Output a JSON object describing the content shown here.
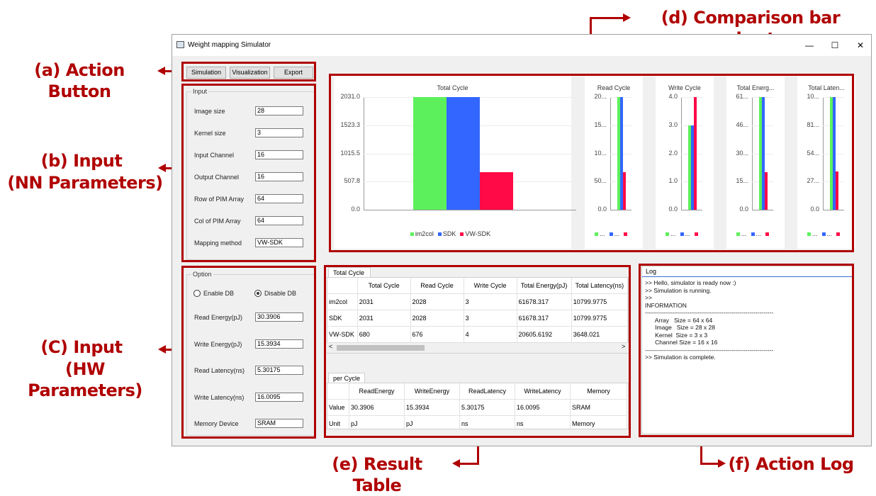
{
  "callouts": {
    "a": "(a) Action Button",
    "b1": "(b) Input",
    "b2": "(NN Parameters)",
    "c1": "(C) Input",
    "c2": "(HW Parameters)",
    "d": "(d) Comparison bar chart",
    "e": "(e) Result Table",
    "f": "(f) Action Log"
  },
  "window": {
    "title": "Weight mapping Simulator",
    "minimize": "—",
    "maximize": "☐",
    "close": "✕"
  },
  "toolbar": {
    "simulation": "Simulation",
    "visualization": "Visualization",
    "export": "Export"
  },
  "input_group": {
    "title": "Input",
    "fields": [
      {
        "label": "Image size",
        "value": "28"
      },
      {
        "label": "Kernel size",
        "value": "3"
      },
      {
        "label": "Input Channel",
        "value": "16"
      },
      {
        "label": "Output Channel",
        "value": "16"
      },
      {
        "label": "Row of PIM Array",
        "value": "64"
      },
      {
        "label": "Col of PIM Array",
        "value": "64"
      },
      {
        "label": "Mapping method",
        "value": "VW-SDK"
      }
    ]
  },
  "option_group": {
    "title": "Option",
    "enable_db": "Enable DB",
    "disable_db": "Disable DB",
    "selected": "Disable DB",
    "fields": [
      {
        "label": "Read Energy(pJ)",
        "value": "30.3906"
      },
      {
        "label": "Write Energy(pJ)",
        "value": "15.3934"
      },
      {
        "label": "Read Latency(ns)",
        "value": "5.30175"
      },
      {
        "label": "Write Latency(ns)",
        "value": "16.0095"
      },
      {
        "label": "Memory Device",
        "value": "SRAM"
      }
    ]
  },
  "colors": {
    "im2col": "#5cf15c",
    "sdk": "#3366ff",
    "vwsdk": "#ff0a47",
    "callout": "#b00000"
  },
  "chart_data": [
    {
      "type": "bar",
      "title": "Total Cycle",
      "categories": [
        "im2col",
        "SDK",
        "VW-SDK"
      ],
      "series": [
        {
          "name": "im2col",
          "values": [
            2031
          ]
        },
        {
          "name": "SDK",
          "values": [
            2031
          ]
        },
        {
          "name": "VW-SDK",
          "values": [
            680
          ]
        }
      ],
      "values": [
        2031,
        2031,
        680
      ],
      "ylim": [
        0,
        2031
      ],
      "yticks": [
        "2031.0",
        "1523.3",
        "1015.5",
        "507.8",
        "0.0"
      ],
      "legend": [
        "im2col",
        "SDK",
        "VW-SDK"
      ],
      "legend_position": "bottom"
    },
    {
      "type": "bar",
      "title": "Read Cycle",
      "categories": [
        "im2col",
        "SDK",
        "VW-SDK"
      ],
      "values": [
        2028,
        2028,
        676
      ],
      "ylim": [
        0,
        2028
      ],
      "yticks": [
        "20...",
        "15...",
        "10...",
        "50...",
        "0.0"
      ],
      "legend": [
        "...",
        "...",
        ""
      ]
    },
    {
      "type": "bar",
      "title": "Write Cycle",
      "categories": [
        "im2col",
        "SDK",
        "VW-SDK"
      ],
      "values": [
        3,
        3,
        4
      ],
      "ylim": [
        0,
        4
      ],
      "yticks": [
        "4.0",
        "3.0",
        "2.0",
        "1.0",
        "0.0"
      ],
      "legend": [
        "...",
        "...",
        ""
      ]
    },
    {
      "type": "bar",
      "title": "Total Energ...",
      "categories": [
        "im2col",
        "SDK",
        "VW-SDK"
      ],
      "values": [
        61678.317,
        61678.317,
        20605.6192
      ],
      "ylim": [
        0,
        61678.317
      ],
      "yticks": [
        "61...",
        "46...",
        "30...",
        "15...",
        "0.0"
      ],
      "legend": [
        "...",
        "...",
        ""
      ]
    },
    {
      "type": "bar",
      "title": "Total Laten...",
      "categories": [
        "im2col",
        "SDK",
        "VW-SDK"
      ],
      "values": [
        10799.9775,
        10799.9775,
        3648.021
      ],
      "ylim": [
        0,
        10799.9775
      ],
      "yticks": [
        "10...",
        "81...",
        "54...",
        "27...",
        "0.0"
      ],
      "legend": [
        "...",
        "...",
        ""
      ]
    }
  ],
  "result_table": {
    "tab": "Total Cycle",
    "headers": [
      "",
      "Total Cycle",
      "Read Cycle",
      "Write Cycle",
      "Total Energy(pJ)",
      "Total Latency(ns)"
    ],
    "rows": [
      [
        "im2col",
        "2031",
        "2028",
        "3",
        "61678.317",
        "10799.9775"
      ],
      [
        "SDK",
        "2031",
        "2028",
        "3",
        "61678.317",
        "10799.9775"
      ],
      [
        "VW-SDK",
        "680",
        "676",
        "4",
        "20605.6192",
        "3648.021"
      ]
    ],
    "scroll_left": "<",
    "scroll_right": ">"
  },
  "per_cycle_table": {
    "tab": "per Cycle",
    "headers": [
      "",
      "ReadEnergy",
      "WriteEnergy",
      "ReadLatency",
      "WriteLatency",
      "Memory"
    ],
    "rows": [
      [
        "Value",
        "30.3906",
        "15.3934",
        "5.30175",
        "16.0095",
        "SRAM"
      ],
      [
        "Unit",
        "pJ",
        "pJ",
        "ns",
        "ns",
        "Memory"
      ]
    ]
  },
  "log": {
    "title": "Log",
    "lines": [
      ">> Hello, simulator is ready now :)",
      ">> Simulation is running.",
      ">>",
      "INFORMATION",
      "----------------------------------------------------------------",
      "      Array   Size = 64 x 64",
      "      Image   Size = 28 x 28",
      "      Kernel  Size = 3 x 3",
      "      Channel Size = 16 x 16",
      "----------------------------------------------------------------",
      ">> Simulation is complete."
    ]
  }
}
